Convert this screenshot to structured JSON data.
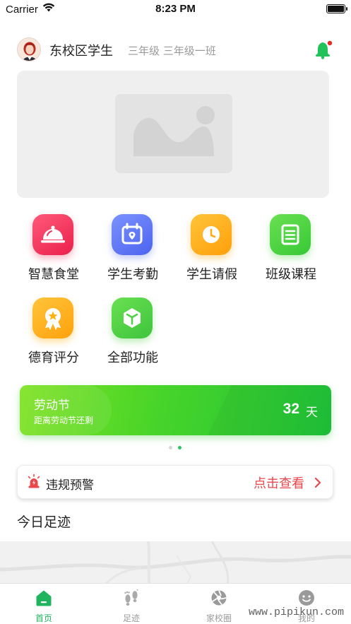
{
  "status_bar": {
    "carrier": "Carrier",
    "time": "8:23 PM"
  },
  "header": {
    "school": "东校区学生",
    "grade": "三年级 三年级一班"
  },
  "functions": [
    {
      "label": "智慧食堂",
      "icon": "cloche-icon",
      "color": "#f0335d"
    },
    {
      "label": "学生考勤",
      "icon": "attendance-calendar-icon",
      "color": "#5872f4"
    },
    {
      "label": "学生请假",
      "icon": "clock-icon",
      "color": "#ffaa17"
    },
    {
      "label": "班级课程",
      "icon": "document-icon",
      "color": "#49d33f"
    },
    {
      "label": "德育评分",
      "icon": "award-badge-icon",
      "color": "#ffb316"
    },
    {
      "label": "全部功能",
      "icon": "cube-icon",
      "color": "#4fd046"
    }
  ],
  "countdown": {
    "title": "劳动节",
    "subtitle": "距离劳动节还剩",
    "value": "32",
    "unit": "天"
  },
  "carousel": {
    "count": 2,
    "active_index": 1
  },
  "warning": {
    "label": "违规预警",
    "link": "点击查看",
    "icon": "alarm-light-icon",
    "link_color": "#e8484c"
  },
  "section": {
    "title": "今日足迹"
  },
  "tabbar": [
    {
      "label": "首页",
      "icon": "home-icon",
      "active": true
    },
    {
      "label": "足迹",
      "icon": "footprints-icon",
      "active": false
    },
    {
      "label": "家校圈",
      "icon": "aperture-icon",
      "active": false
    },
    {
      "label": "我的",
      "icon": "smiley-face-icon",
      "active": false
    }
  ],
  "watermark": "www.pipikun.com",
  "colors": {
    "accent_green": "#21b45f",
    "notification_dot": "#e82a2a"
  }
}
